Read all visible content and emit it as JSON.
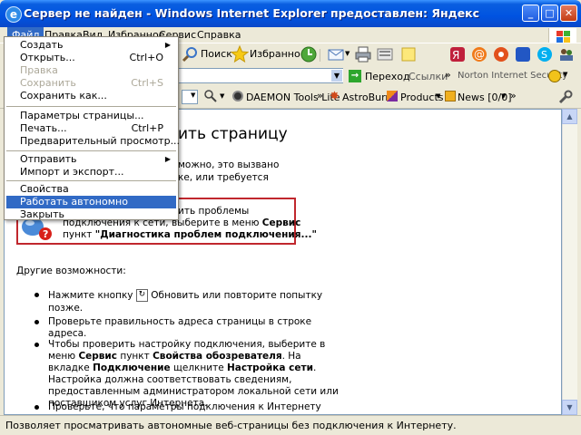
{
  "window": {
    "title": "Сервер не найден - Windows Internet Explorer предоставлен: Яндекс",
    "min": "_",
    "max": "□",
    "close": "✕",
    "icon": "e"
  },
  "menubar": {
    "items": [
      "Файл",
      "Правка",
      "Вид",
      "Избранное",
      "Сервис",
      "Справка"
    ]
  },
  "toolbar": {
    "search": "Поиск",
    "favorites": "Избранное"
  },
  "addressbar": {
    "go": "Переход",
    "links": "Ссылки",
    "norton": "Norton Internet Security",
    "more": "»"
  },
  "linksbar": {
    "daemon": "DAEMON Tools Lite",
    "astroburn": "AstroBurn",
    "products": "Products",
    "news": "News [0/0]"
  },
  "file_menu": {
    "items": [
      {
        "label": "Создать",
        "shortcut": "",
        "submenu": true,
        "disabled": false
      },
      {
        "label": "Открыть...",
        "shortcut": "Ctrl+O",
        "submenu": false,
        "disabled": false
      },
      {
        "label": "Правка",
        "shortcut": "",
        "submenu": false,
        "disabled": true
      },
      {
        "label": "Сохранить",
        "shortcut": "Ctrl+S",
        "submenu": false,
        "disabled": true
      },
      {
        "label": "Сохранить как...",
        "shortcut": "",
        "submenu": false,
        "disabled": false
      },
      {
        "label": "Параметры страницы...",
        "shortcut": "",
        "submenu": false,
        "disabled": false
      },
      {
        "label": "Печать...",
        "shortcut": "Ctrl+P",
        "submenu": false,
        "disabled": false
      },
      {
        "label": "Предварительный просмотр...",
        "shortcut": "",
        "submenu": false,
        "disabled": false
      },
      {
        "label": "Отправить",
        "shortcut": "",
        "submenu": true,
        "disabled": false
      },
      {
        "label": "Импорт и экспорт...",
        "shortcut": "",
        "submenu": false,
        "disabled": false
      },
      {
        "label": "Свойства",
        "shortcut": "",
        "submenu": false,
        "disabled": false
      },
      {
        "label": "Работать автономно",
        "shortcut": "",
        "submenu": false,
        "disabled": false
      },
      {
        "label": "Закрыть",
        "shortcut": "",
        "submenu": false,
        "disabled": false
      }
    ],
    "highlighted": "Работать автономно"
  },
  "page": {
    "heading_fragment": "ить страницу",
    "line1": "можно, это вызвано",
    "line2": "ке, или требуется",
    "box_line1": "ить проблемы",
    "box_line2_a": "подключения к сети, выберите в меню ",
    "box_line2_b": "Сервис",
    "box_line3_a": "пункт ",
    "box_line3_b": "\"Диагностика проблем подключения...\"",
    "other_title": "Другие возможности:",
    "b1_a": "Нажмите кнопку",
    "b1_b": "Обновить или повторите попытку",
    "b1_c": "позже.",
    "b2_a": "Проверьте правильность адреса страницы в строке",
    "b2_b": "адреса.",
    "b3_a": "Чтобы проверить настройку подключения, выберите в",
    "b3_b1": "меню ",
    "b3_b2": "Сервис",
    "b3_b3": " пункт ",
    "b3_b4": "Свойства обозревателя",
    "b3_b5": ". На",
    "b3_c1": "вкладке ",
    "b3_c2": "Подключение",
    "b3_c3": " щелкните ",
    "b3_c4": "Настройка сети",
    "b3_c5": ".",
    "b3_d": "Настройка должна соответствовать сведениям,",
    "b3_e": "предоставленным администратором локальной сети или",
    "b3_f": "поставщиком услуг Интернета.",
    "b4_a": "Проверьте, что параметры подключения к Интернету"
  },
  "status": {
    "text": "Позволяет просматривать автономные веб-страницы без подключения к Интернету."
  }
}
